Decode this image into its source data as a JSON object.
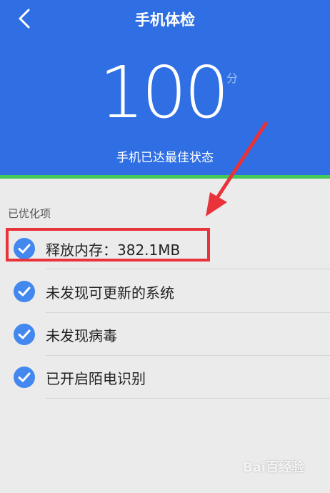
{
  "header": {
    "title": "手机体检",
    "score": "100",
    "score_unit": "分",
    "status": "手机已达最佳状态",
    "background": "#2f6fe3",
    "accent_line": "#43c957"
  },
  "section": {
    "title": "已优化项"
  },
  "items": [
    {
      "label": "释放内存：382.1MB",
      "icon": "check-circle-icon"
    },
    {
      "label": "未发现可更新的系统",
      "icon": "check-circle-icon"
    },
    {
      "label": "未发现病毒",
      "icon": "check-circle-icon"
    },
    {
      "label": "已开启陌电识别",
      "icon": "check-circle-icon"
    }
  ],
  "annotation": {
    "color": "#e8333a"
  },
  "watermark": "Bai百经验"
}
